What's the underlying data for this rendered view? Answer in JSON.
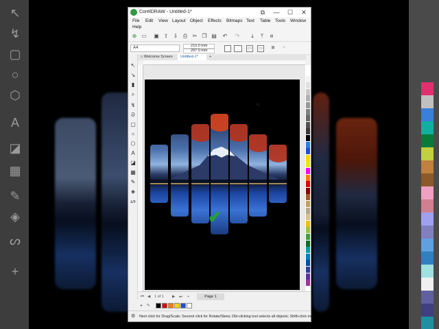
{
  "window": {
    "title": "CorelDRAW - Untitled-1*",
    "minimize": "—",
    "maximize": "☐",
    "close": "✕",
    "restore_icon": "⧉"
  },
  "menu": {
    "items": [
      "File",
      "Edit",
      "View",
      "Layout",
      "Object",
      "Effects",
      "Bitmaps",
      "Text",
      "Table",
      "Tools",
      "Window",
      "Help"
    ]
  },
  "property_bar": {
    "page_size": "A4",
    "width": "210.0 mm",
    "height": "297.0 mm"
  },
  "tabs": {
    "welcome": "Welcome Screen",
    "document": "Untitled-1*",
    "add": "+"
  },
  "page_navigator": {
    "first": "⏮",
    "prev": "◀",
    "count": "1 of 1",
    "next": "▶",
    "last": "⏭",
    "add": "+",
    "page_tab": "Page 1"
  },
  "status": {
    "text": "Next click for Drag/Scale; Second click for Rotate/Skew; Dbl-clicking tool selects all objects; Shift+click mu"
  },
  "colors": {
    "accent": "#2e9b3e",
    "check": "#27a32e",
    "palette": [
      "#ffffff",
      "#f2f2f2",
      "#e0e0e0",
      "#c8c8c8",
      "#b0b0b0",
      "#989898",
      "#808080",
      "#686868",
      "#505050",
      "#383838",
      "#000000",
      "#2a7de1",
      "#1f4fd6",
      "#ffd400",
      "#e8e800",
      "#ff00ff",
      "#ff7a00",
      "#e00000",
      "#8b0000",
      "#a35a2a",
      "#c0a060",
      "#b7a98a",
      "#d9c08f",
      "#f0c000",
      "#a0c040",
      "#40a040",
      "#107020",
      "#00a0a0",
      "#0080c0",
      "#0050a0",
      "#3040a0",
      "#6030a0",
      "#a030a0"
    ],
    "document_palette": [
      "#000000",
      "#e00000",
      "#ff7a00",
      "#ffd400",
      "#1f4fd6",
      "#ffffff"
    ]
  }
}
